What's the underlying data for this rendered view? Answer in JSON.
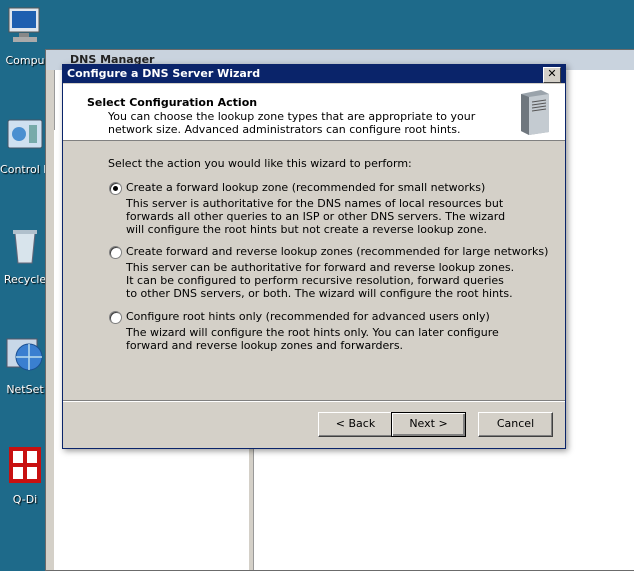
{
  "desktop": {
    "icons": [
      {
        "label": "Compu"
      },
      {
        "label": "Control P"
      },
      {
        "label": "Recycle"
      },
      {
        "label": "NetSet"
      },
      {
        "label": "Q-Di"
      }
    ]
  },
  "dns_manager": {
    "title": "DNS Manager"
  },
  "wizard": {
    "title": "Configure a DNS Server Wizard",
    "close_label": "✕",
    "header_title": "Select Configuration Action",
    "header_subtitle": "You can choose the lookup zone types that are appropriate to your network size. Advanced administrators can configure root hints.",
    "prompt": "Select the action you would like this wizard to perform:",
    "options": [
      {
        "label": "Create a forward lookup zone (recommended for small networks)",
        "description": "This server is authoritative for the DNS names of local resources but forwards all other queries to an ISP or other DNS servers. The wizard will configure the root hints but not create a reverse lookup zone.",
        "selected": true
      },
      {
        "label": "Create forward and reverse lookup zones (recommended for large networks)",
        "description": "This server can be authoritative for forward and reverse lookup zones. It can be configured to perform recursive resolution, forward queries to other DNS servers, or both. The wizard will configure the root hints.",
        "selected": false
      },
      {
        "label": "Configure root hints only (recommended for advanced users only)",
        "description": "The wizard will configure the root hints only. You can later configure forward and reverse lookup zones and forwarders.",
        "selected": false
      }
    ],
    "buttons": {
      "back": "< Back",
      "next": "Next >",
      "cancel": "Cancel"
    }
  }
}
